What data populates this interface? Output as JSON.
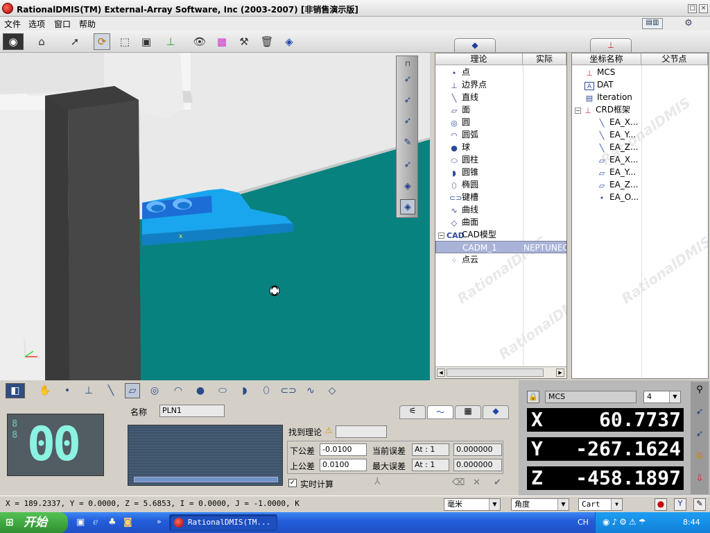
{
  "window": {
    "title": "RationalDMIS(TM) External-Array Software, Inc (2003-2007) [非销售演示版]",
    "controls": [
      "□",
      "×"
    ]
  },
  "menu": [
    "文件",
    "选项",
    "窗口",
    "帮助"
  ],
  "viewport": {
    "watermark": "RationalDMIS"
  },
  "theory_panel": {
    "col_theory": "理论",
    "col_actual": "实际",
    "items": [
      {
        "label": "点",
        "icon": "point-icon"
      },
      {
        "label": "边界点",
        "icon": "edge-point-icon"
      },
      {
        "label": "直线",
        "icon": "line-icon"
      },
      {
        "label": "面",
        "icon": "plane-icon"
      },
      {
        "label": "圆",
        "icon": "circle-icon"
      },
      {
        "label": "圆弧",
        "icon": "arc-icon"
      },
      {
        "label": "球",
        "icon": "sphere-icon"
      },
      {
        "label": "圆柱",
        "icon": "cylinder-icon"
      },
      {
        "label": "圆锥",
        "icon": "cone-icon"
      },
      {
        "label": "椭圆",
        "icon": "ellipse-icon"
      },
      {
        "label": "键槽",
        "icon": "slot-icon"
      },
      {
        "label": "曲线",
        "icon": "curve-icon"
      },
      {
        "label": "曲面",
        "icon": "surface-icon"
      },
      {
        "label": "CAD模型",
        "icon": "cad-icon"
      },
      {
        "label": "CADM_1",
        "actual": "NEPTUNEC",
        "selected": true
      },
      {
        "label": "点云",
        "icon": "point-cloud-icon"
      }
    ]
  },
  "coord_panel": {
    "col_name": "坐标名称",
    "col_parent": "父节点",
    "items": [
      "MCS",
      "DAT",
      "Iteration",
      "CRD框架",
      "EA_X...",
      "EA_Y...",
      "EA_Z...",
      "EA_X...",
      "EA_Y...",
      "EA_Z...",
      "EA_O..."
    ]
  },
  "feature_panel": {
    "led": "00",
    "name_label": "名称",
    "name_value": "PLN1",
    "found_theory_label": "找到理论",
    "lower_tol_label": "下公差",
    "lower_tol_value": "-0.0100",
    "upper_tol_label": "上公差",
    "upper_tol_value": "0.0100",
    "cur_err_label": "当前误差",
    "max_err_label": "最大误差",
    "at1": "At : 1",
    "at2": "At : 1",
    "cur_err_value": "0.000000",
    "max_err_value": "0.000000",
    "realtime_label": "实时计算"
  },
  "readout": {
    "coord_system": "MCS",
    "digits": "4",
    "x_label": "X",
    "x_value": "60.7737",
    "y_label": "Y",
    "y_value": "-267.1624",
    "z_label": "Z",
    "z_value": "-458.1897"
  },
  "status": {
    "text": "X = 189.2337, Y = 0.0000, Z = 5.6853, I = 0.0000, J = -1.0000, K = 0.0",
    "unit": "毫米",
    "angle": "角度",
    "coord_type": "Cart"
  },
  "taskbar": {
    "start": "开始",
    "task": "RationalDMIS(TM...",
    "lang": "CH",
    "time": "8:44"
  },
  "colors": {
    "viewport_bg": "#08827f",
    "part": "#1aa6ee",
    "selected_row": "#a9b3d8"
  }
}
